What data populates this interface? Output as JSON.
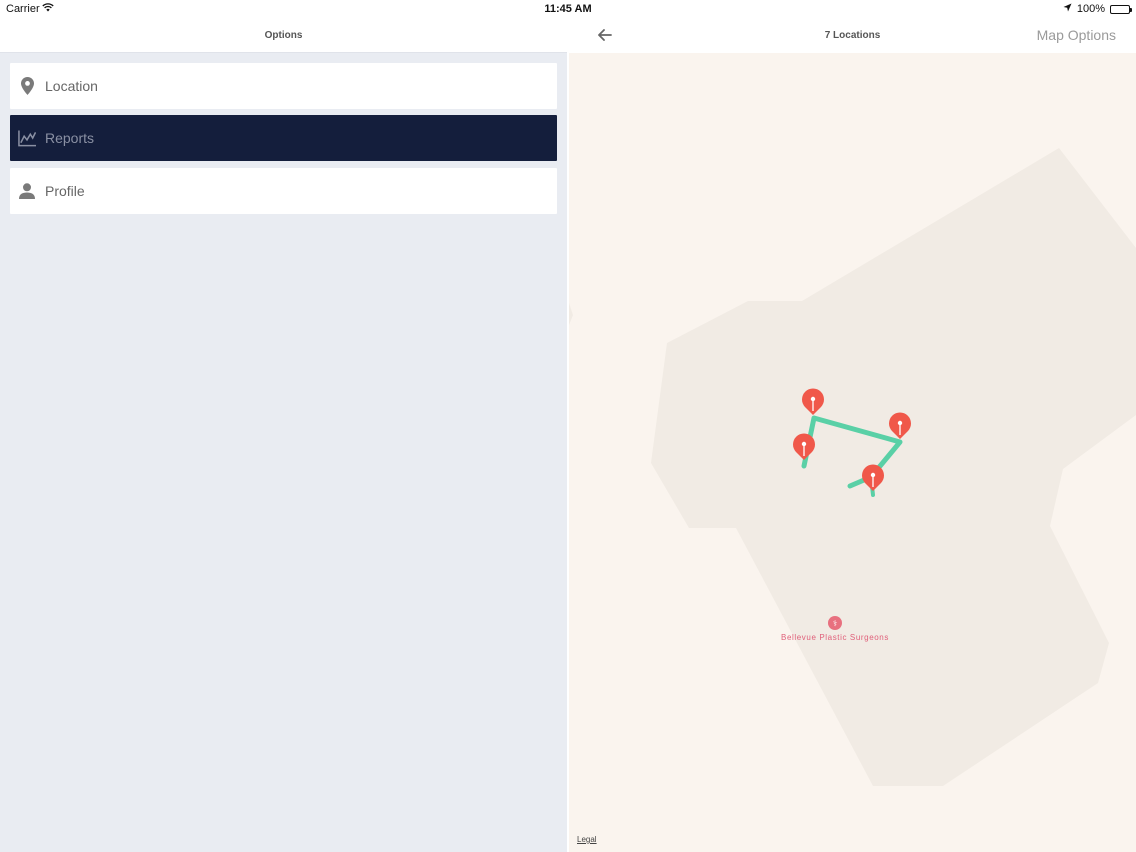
{
  "status_bar": {
    "carrier": "Carrier",
    "time": "11:45 AM",
    "battery": "100%"
  },
  "left_panel": {
    "title": "Options",
    "items": [
      {
        "label": "Location",
        "icon": "map-pin-icon",
        "active": false
      },
      {
        "label": "Reports",
        "icon": "line-chart-icon",
        "active": true
      },
      {
        "label": "Profile",
        "icon": "user-icon",
        "active": false
      }
    ]
  },
  "right_panel": {
    "title": "7 Locations",
    "back_icon": "arrow-left-icon",
    "map_options_label": "Map Options",
    "map": {
      "poi_label": "Bellevue Plastic Surgeons",
      "poi_icon": "medical-icon",
      "legal_label": "Legal",
      "route_color": "#5ad0a6",
      "pin_color": "#f0584a"
    }
  },
  "colors": {
    "active_item_bg": "#141e3c",
    "panel_bg": "#e9ecf2",
    "map_bg": "#faf4ee"
  }
}
